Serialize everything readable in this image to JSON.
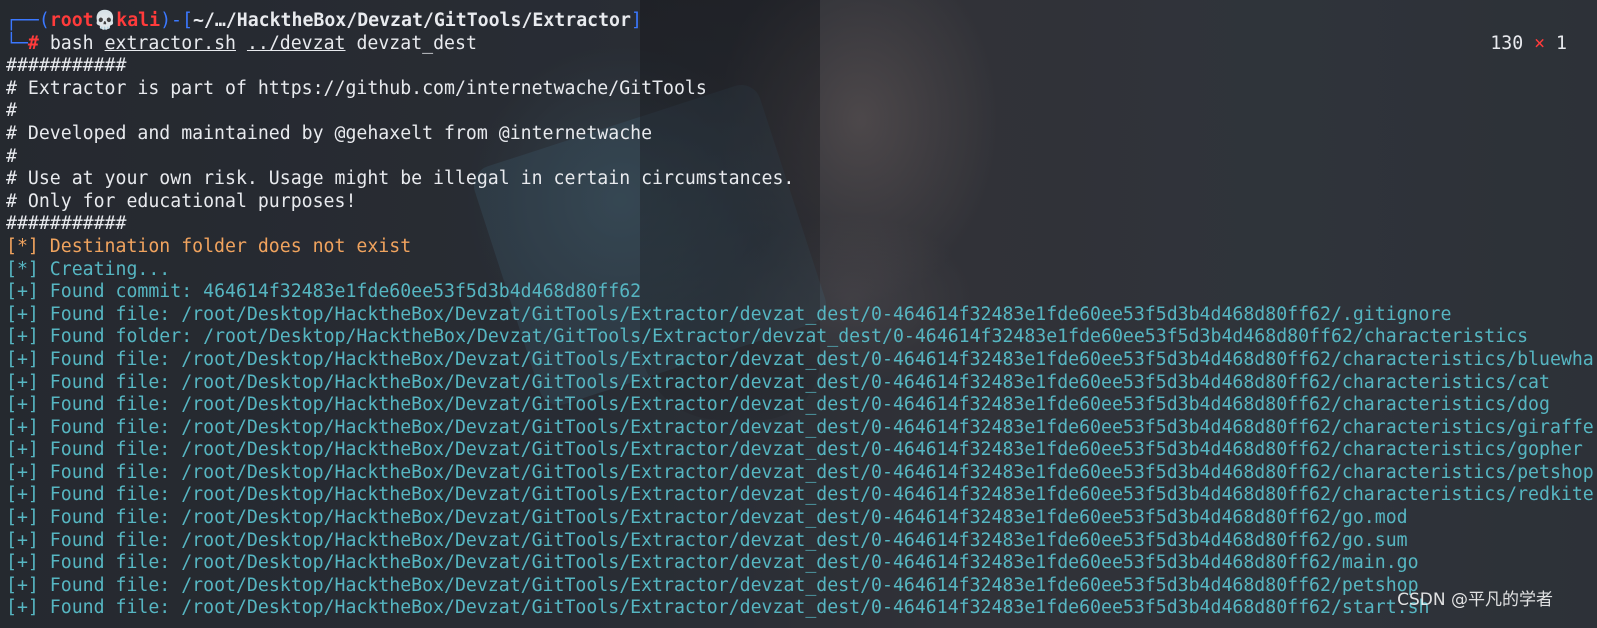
{
  "prompt": {
    "line1_prefix": "┌──(",
    "user": "root",
    "skull": "💀",
    "host": "kali",
    "line1_mid": ")-[",
    "cwd": "~/…/HacktheBox/Devzat/GitTools/Extractor",
    "line1_suffix": "]",
    "line2_prefix": "└─",
    "hash": "#",
    "cmd_bash": "bash",
    "cmd_script": "extractor.sh",
    "cmd_arg1": "../devzat",
    "cmd_arg2": "devzat_dest",
    "right_status_code": "130",
    "right_status_x": "×",
    "right_status_count": "1"
  },
  "banner": [
    "###########",
    "# Extractor is part of https://github.com/internetwache/GitTools",
    "#",
    "# Developed and maintained by @gehaxelt from @internetwache",
    "#",
    "# Use at your own risk. Usage might be illegal in certain circumstances.",
    "# Only for educational purposes!",
    "###########"
  ],
  "status_lines": [
    {
      "tag": "[*]",
      "text": " Destination folder does not exist",
      "color": "orange"
    },
    {
      "tag": "[*]",
      "text": " Creating...",
      "color": "cyan"
    }
  ],
  "found_lines": [
    {
      "tag": "[+]",
      "label": " Found commit:",
      "value": " 464614f32483e1fde60ee53f5d3b4d468d80ff62"
    },
    {
      "tag": "[+]",
      "label": " Found file:",
      "value": " /root/Desktop/HacktheBox/Devzat/GitTools/Extractor/devzat_dest/0-464614f32483e1fde60ee53f5d3b4d468d80ff62/.gitignore"
    },
    {
      "tag": "[+]",
      "label": " Found folder:",
      "value": " /root/Desktop/HacktheBox/Devzat/GitTools/Extractor/devzat_dest/0-464614f32483e1fde60ee53f5d3b4d468d80ff62/characteristics"
    },
    {
      "tag": "[+]",
      "label": " Found file:",
      "value": " /root/Desktop/HacktheBox/Devzat/GitTools/Extractor/devzat_dest/0-464614f32483e1fde60ee53f5d3b4d468d80ff62/characteristics/bluewha"
    },
    {
      "tag": "[+]",
      "label": " Found file:",
      "value": " /root/Desktop/HacktheBox/Devzat/GitTools/Extractor/devzat_dest/0-464614f32483e1fde60ee53f5d3b4d468d80ff62/characteristics/cat"
    },
    {
      "tag": "[+]",
      "label": " Found file:",
      "value": " /root/Desktop/HacktheBox/Devzat/GitTools/Extractor/devzat_dest/0-464614f32483e1fde60ee53f5d3b4d468d80ff62/characteristics/dog"
    },
    {
      "tag": "[+]",
      "label": " Found file:",
      "value": " /root/Desktop/HacktheBox/Devzat/GitTools/Extractor/devzat_dest/0-464614f32483e1fde60ee53f5d3b4d468d80ff62/characteristics/giraffe"
    },
    {
      "tag": "[+]",
      "label": " Found file:",
      "value": " /root/Desktop/HacktheBox/Devzat/GitTools/Extractor/devzat_dest/0-464614f32483e1fde60ee53f5d3b4d468d80ff62/characteristics/gopher"
    },
    {
      "tag": "[+]",
      "label": " Found file:",
      "value": " /root/Desktop/HacktheBox/Devzat/GitTools/Extractor/devzat_dest/0-464614f32483e1fde60ee53f5d3b4d468d80ff62/characteristics/petshop"
    },
    {
      "tag": "[+]",
      "label": " Found file:",
      "value": " /root/Desktop/HacktheBox/Devzat/GitTools/Extractor/devzat_dest/0-464614f32483e1fde60ee53f5d3b4d468d80ff62/characteristics/redkite"
    },
    {
      "tag": "[+]",
      "label": " Found file:",
      "value": " /root/Desktop/HacktheBox/Devzat/GitTools/Extractor/devzat_dest/0-464614f32483e1fde60ee53f5d3b4d468d80ff62/go.mod"
    },
    {
      "tag": "[+]",
      "label": " Found file:",
      "value": " /root/Desktop/HacktheBox/Devzat/GitTools/Extractor/devzat_dest/0-464614f32483e1fde60ee53f5d3b4d468d80ff62/go.sum"
    },
    {
      "tag": "[+]",
      "label": " Found file:",
      "value": " /root/Desktop/HacktheBox/Devzat/GitTools/Extractor/devzat_dest/0-464614f32483e1fde60ee53f5d3b4d468d80ff62/main.go"
    },
    {
      "tag": "[+]",
      "label": " Found file:",
      "value": " /root/Desktop/HacktheBox/Devzat/GitTools/Extractor/devzat_dest/0-464614f32483e1fde60ee53f5d3b4d468d80ff62/petshop"
    },
    {
      "tag": "[+]",
      "label": " Found file:",
      "value": " /root/Desktop/HacktheBox/Devzat/GitTools/Extractor/devzat_dest/0-464614f32483e1fde60ee53f5d3b4d468d80ff62/start.sh"
    }
  ],
  "watermark": "CSDN @平凡的学者",
  "colors": {
    "prompt_box": "#3b78ff",
    "prompt_user": "#ff3b3b",
    "warning_orange": "#f0a35e",
    "info_cyan": "#56b6c2",
    "text": "#e8eaee"
  }
}
